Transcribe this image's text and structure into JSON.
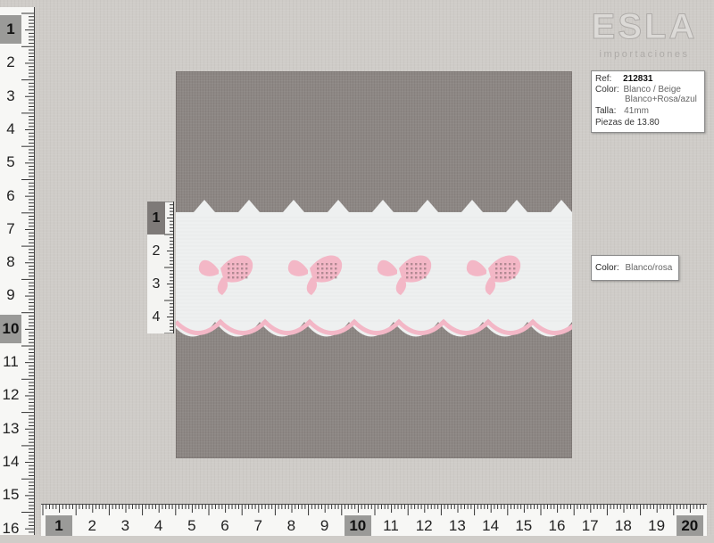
{
  "logo": {
    "word": "ESLA",
    "tagline": "importaciones"
  },
  "product_card": {
    "ref_label": "Ref:",
    "ref_value": "212831",
    "color_label": "Color:",
    "color_line1": "Blanco / Beige",
    "color_line2": "Blanco+Rosa/azul",
    "size_label": "Talla:",
    "size_value": "41mm",
    "pieces_text": "Piezas de 13.80"
  },
  "color_card": {
    "label": "Color:",
    "value": "Blanco/rosa"
  },
  "left_ruler": {
    "numbers": [
      "1",
      "2",
      "3",
      "4",
      "5",
      "6",
      "7",
      "8",
      "9",
      "10",
      "11",
      "12",
      "13",
      "14",
      "15",
      "16"
    ],
    "highlighted": [
      "1",
      "10"
    ]
  },
  "bottom_ruler": {
    "numbers": [
      "1",
      "2",
      "3",
      "4",
      "5",
      "6",
      "7",
      "8",
      "9",
      "10",
      "11",
      "12",
      "13",
      "14",
      "15",
      "16",
      "17",
      "18",
      "19",
      "20"
    ],
    "highlighted": [
      "1",
      "10",
      "20"
    ]
  },
  "sample_ruler": {
    "numbers": [
      "1",
      "2",
      "3",
      "4"
    ],
    "highlighted": [
      "1"
    ]
  },
  "colors": {
    "background": "#cfccc8",
    "board": "#8d8784",
    "fabric": "#eef0f0",
    "embroidery": "#f3b7c6",
    "ruler_highlight": "#9a9a98"
  }
}
